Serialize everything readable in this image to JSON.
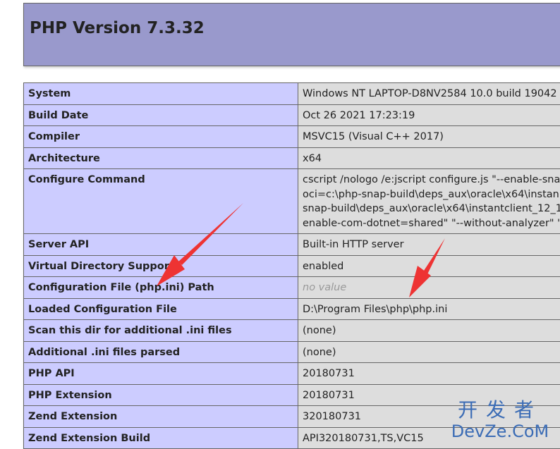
{
  "header": {
    "title": "PHP Version 7.3.32"
  },
  "rows": [
    {
      "label": "System",
      "value": [
        "Windows NT LAPTOP-D8NV2584 10.0 build 19042"
      ]
    },
    {
      "label": "Build Date",
      "value": [
        "Oct 26 2021 17:23:19"
      ]
    },
    {
      "label": "Compiler",
      "value": [
        "MSVC15 (Visual C++ 2017)"
      ]
    },
    {
      "label": "Architecture",
      "value": [
        "x64"
      ]
    },
    {
      "label": "Configure Command",
      "value": [
        "cscript /nologo /e:jscript configure.js \"--enable-sna",
        "oci=c:\\php-snap-build\\deps_aux\\oracle\\x64\\instan",
        "snap-build\\deps_aux\\oracle\\x64\\instantclient_12_1",
        "enable-com-dotnet=shared\" \"--without-analyzer\" \""
      ]
    },
    {
      "label": "Server API",
      "value": [
        "Built-in HTTP server"
      ]
    },
    {
      "label": "Virtual Directory Support",
      "value": [
        "enabled"
      ]
    },
    {
      "label": "Configuration File (php.ini) Path",
      "value": [
        "no value"
      ],
      "novalue": true
    },
    {
      "label": "Loaded Configuration File",
      "value": [
        "D:\\Program Files\\php\\php.ini"
      ]
    },
    {
      "label": "Scan this dir for additional .ini files",
      "value": [
        "(none)"
      ]
    },
    {
      "label": "Additional .ini files parsed",
      "value": [
        "(none)"
      ]
    },
    {
      "label": "PHP API",
      "value": [
        "20180731"
      ]
    },
    {
      "label": "PHP Extension",
      "value": [
        "20180731"
      ]
    },
    {
      "label": "Zend Extension",
      "value": [
        "320180731"
      ]
    },
    {
      "label": "Zend Extension Build",
      "value": [
        "API320180731,TS,VC15"
      ]
    }
  ],
  "watermark": {
    "cn": "开发者",
    "en": "DevZe.CoM"
  },
  "colors": {
    "header_bg": "#9999cc",
    "label_bg": "#ccccff",
    "value_bg": "#dddddd",
    "arrow": "#ee3333"
  }
}
